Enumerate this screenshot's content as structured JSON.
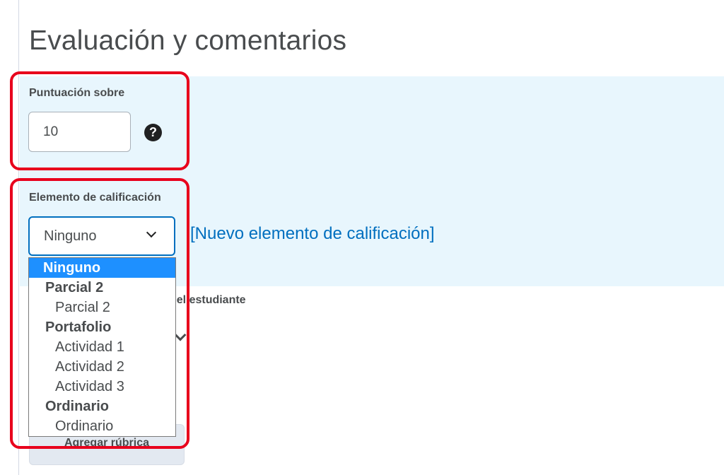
{
  "page": {
    "title": "Evaluación y comentarios"
  },
  "score": {
    "label": "Puntuación sobre",
    "value": "10",
    "help_icon": "question-circle-icon"
  },
  "grade_item": {
    "label": "Elemento de calificación",
    "selected": "Ninguno",
    "new_link": "[Nuevo elemento de calificación]",
    "options": [
      {
        "label": "Ninguno",
        "kind": "option",
        "selected": true
      },
      {
        "label": "Parcial 2",
        "kind": "group"
      },
      {
        "label": "Parcial 2",
        "kind": "option"
      },
      {
        "label": "Portafolio",
        "kind": "group"
      },
      {
        "label": "Actividad 1",
        "kind": "option"
      },
      {
        "label": "Actividad 2",
        "kind": "option"
      },
      {
        "label": "Actividad 3",
        "kind": "option"
      },
      {
        "label": "Ordinario",
        "kind": "group"
      },
      {
        "label": "Ordinario",
        "kind": "option"
      }
    ]
  },
  "partially_hidden": {
    "student_label_fragment": "del estudiante",
    "rubric_button": "Agregar rúbrica"
  },
  "colors": {
    "panel_bg": "#e8f6fd",
    "accent": "#006fbf",
    "selected_option": "#1e90ff",
    "annotation": "#e8001c"
  }
}
